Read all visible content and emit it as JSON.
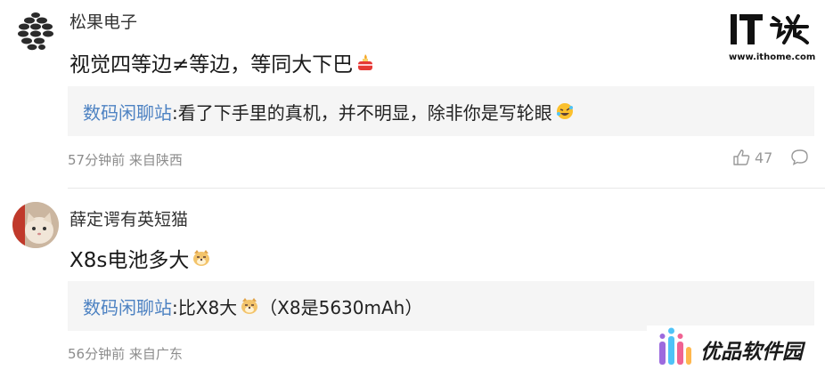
{
  "comments": [
    {
      "username": "松果电子",
      "text": "视觉四等边≠等边，等同大下巴",
      "text_emoji": "fire-cake-emoji",
      "reply": {
        "author": "数码闲聊站",
        "text": ":看了下手里的真机，并不明显，除非你是写轮眼",
        "emoji": "rofl-emoji"
      },
      "time": "57分钟前",
      "location": "来自陕西",
      "likes": "47"
    },
    {
      "username": "薛定谔有英短猫",
      "text": "X8s电池多大",
      "text_emoji": "doge-emoji",
      "reply": {
        "author": "数码闲聊站",
        "text_before": ":比X8大",
        "emoji": "doge-emoji",
        "text_after": "（X8是5630mAh）"
      },
      "time": "56分钟前",
      "location": "来自广东"
    }
  ],
  "branding": {
    "ithome_url": "www.ithome.com",
    "watermark": "优品软件园"
  },
  "colors": {
    "reply_author": "#4d82c2",
    "reply_bg": "#f5f5f5",
    "meta": "#8c8c8c"
  }
}
